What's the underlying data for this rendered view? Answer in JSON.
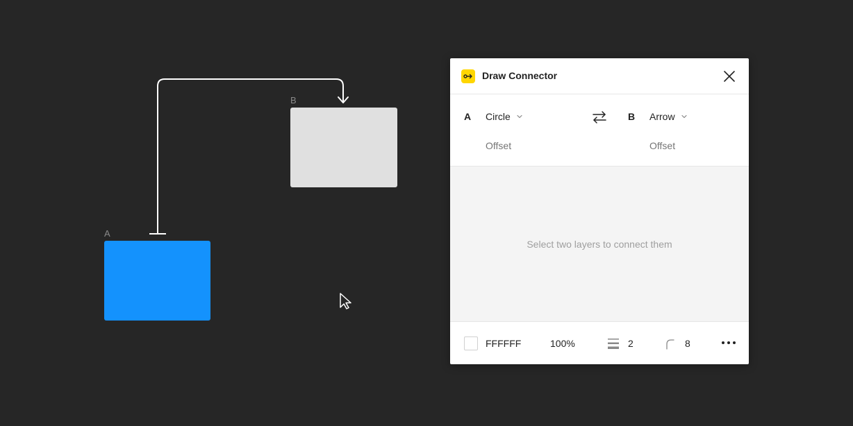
{
  "canvas": {
    "layer_a": {
      "label": "A",
      "color": "#1492fd"
    },
    "layer_b": {
      "label": "B",
      "color": "#e0e0e0"
    },
    "connector_color": "#ffffff",
    "background": "#262626"
  },
  "panel": {
    "title": "Draw Connector",
    "icon": "connector-plugin-icon",
    "start": {
      "label": "A",
      "cap": "Circle",
      "offset_placeholder": "Offset"
    },
    "end": {
      "label": "B",
      "cap": "Arrow",
      "offset_placeholder": "Offset"
    },
    "empty_message": "Select two layers to connect them",
    "footer": {
      "color_hex": "FFFFFF",
      "opacity": "100%",
      "stroke_weight": "2",
      "corner_radius": "8"
    }
  }
}
